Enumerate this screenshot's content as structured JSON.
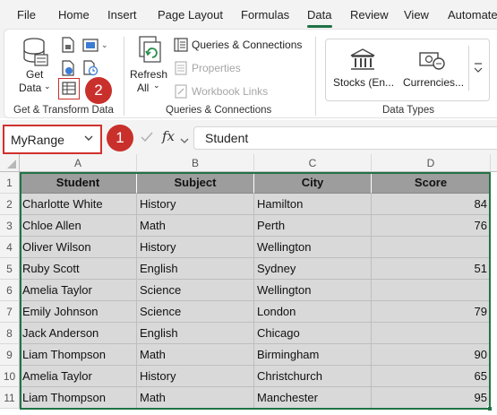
{
  "tabs": [
    "File",
    "Home",
    "Insert",
    "Page Layout",
    "Formulas",
    "Data",
    "Review",
    "View",
    "Automate"
  ],
  "active_tab": "Data",
  "ribbon": {
    "get_data": {
      "line1": "Get",
      "line2": "Data"
    },
    "refresh_all": {
      "line1": "Refresh",
      "line2": "All"
    },
    "queries_connections": "Queries & Connections",
    "properties": "Properties",
    "workbook_links": "Workbook Links",
    "stocks": "Stocks (En...",
    "currencies": "Currencies...",
    "group_labels": {
      "get_transform": "Get & Transform Data",
      "queries": "Queries & Connections",
      "data_types": "Data Types"
    }
  },
  "annotations": {
    "step1": "1",
    "step2": "2"
  },
  "formula_bar": {
    "name_box": "MyRange",
    "fx": "fx",
    "value": "Student"
  },
  "sheet": {
    "columns": [
      "A",
      "B",
      "C",
      "D"
    ],
    "rows": [
      "1",
      "2",
      "3",
      "4",
      "5",
      "6",
      "7",
      "8",
      "9",
      "10",
      "11"
    ],
    "header": [
      "Student",
      "Subject",
      "City",
      "Score"
    ],
    "data": [
      [
        "Charlotte White",
        "History",
        "Hamilton",
        "84"
      ],
      [
        "Chloe Allen",
        "Math",
        "Perth",
        "76"
      ],
      [
        "Oliver Wilson",
        "History",
        "Wellington",
        ""
      ],
      [
        "Ruby Scott",
        "English",
        "Sydney",
        "51"
      ],
      [
        "Amelia Taylor",
        "Science",
        "Wellington",
        ""
      ],
      [
        "Emily Johnson",
        "Science",
        "London",
        "79"
      ],
      [
        "Jack Anderson",
        "English",
        "Chicago",
        ""
      ],
      [
        "Liam Thompson",
        "Math",
        "Birmingham",
        "90"
      ],
      [
        "Amelia Taylor",
        "History",
        "Christchurch",
        "65"
      ],
      [
        "Liam Thompson",
        "Math",
        "Manchester",
        "95"
      ]
    ]
  },
  "colors": {
    "accent_green": "#217346",
    "annotation_red": "#c9302c",
    "header_fill": "#9d9d9d",
    "data_fill": "#d9d9d9"
  }
}
